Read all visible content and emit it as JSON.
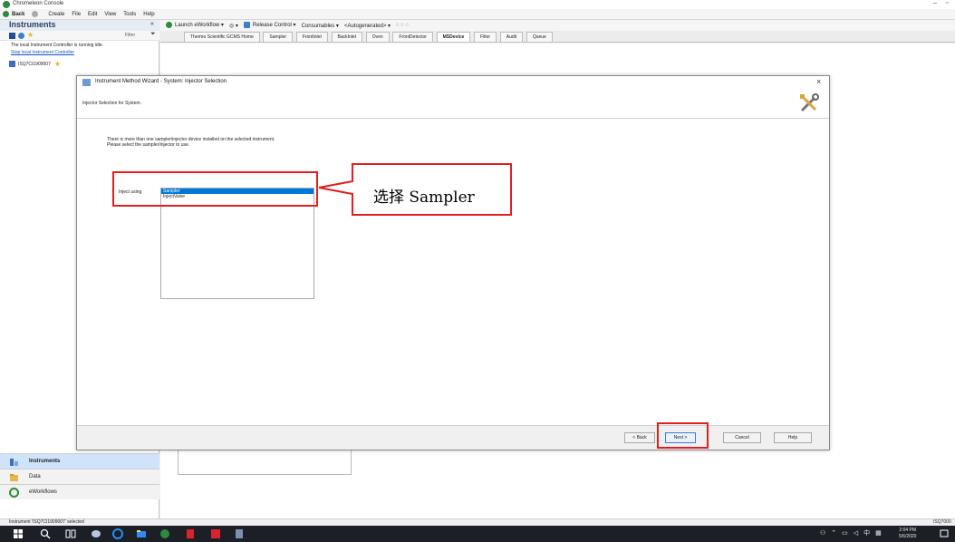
{
  "window": {
    "title": "Chromeleon Console"
  },
  "menu": [
    "Back",
    "Create",
    "File",
    "Edit",
    "View",
    "Tools",
    "Help"
  ],
  "left_panel": {
    "header": "Instruments",
    "filter_label": "Filter",
    "status_idle": "The local Instrument Controller is running idle.",
    "stop_link": "Stop local Instrument Controller",
    "instrument_name": "ISQ7CI1909007"
  },
  "toolbar": [
    "Launch eWorkflow",
    "Release Control",
    "Consumables",
    "<Autogenerated>"
  ],
  "tabs": [
    "Thermo Scientific GCMS Home",
    "Sampler",
    "FrontInlet",
    "BackInlet",
    "Oven",
    "FrontDetector",
    "MSDevice",
    "Filter",
    "Audit",
    "Queue"
  ],
  "active_tab": "MSDevice",
  "dialog": {
    "title": "Instrument Method Wizard - System: Injector Selection",
    "header": "Injector Selection for System.",
    "info_line1": "There is more than one sampler/injector device installed on the selected instrument.",
    "info_line2": "Please select the sampler/injector to use.",
    "inject_label": "Inject using",
    "options": [
      "Sampler",
      "InjectValve"
    ],
    "selected_option": "Sampler",
    "buttons": {
      "back": "< Back",
      "next": "Next >",
      "cancel": "Cancel",
      "help": "Help"
    }
  },
  "annotation": {
    "text": "选择 Sampler",
    "color": "#e02020"
  },
  "nav": {
    "instruments": "Instruments",
    "data": "Data",
    "eworkflows": "eWorkflows"
  },
  "status_bar": {
    "text": "Instrument 'ISQ7CI1909007' selected",
    "right": "ISQ7000"
  },
  "taskbar": {
    "time": "2:04 PM",
    "date": "5/6/2020",
    "ime": "中"
  },
  "colors": {
    "accent": "#0078d7",
    "annotation": "#e02020",
    "taskbar": "#1c1f26"
  }
}
